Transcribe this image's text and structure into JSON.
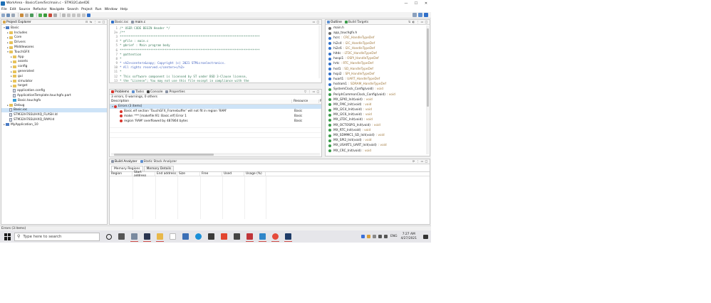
{
  "window": {
    "title": "WorkArea - Basic/Core/Src/main.c - STM32CubeIDE",
    "controls": [
      "—",
      "☐",
      "✕"
    ]
  },
  "menu": [
    "File",
    "Edit",
    "Source",
    "Refactor",
    "Navigate",
    "Search",
    "Project",
    "Run",
    "Window",
    "Help"
  ],
  "project_explorer": {
    "title": "Project Explorer",
    "tree": [
      {
        "label": "Basic",
        "depth": 0,
        "twisty": "▾",
        "icon": "project-icon"
      },
      {
        "label": "Includes",
        "depth": 1,
        "twisty": "▸",
        "icon": "folder-icon"
      },
      {
        "label": "Core",
        "depth": 1,
        "twisty": "▸",
        "icon": "folder-icon"
      },
      {
        "label": "Drivers",
        "depth": 1,
        "twisty": "▸",
        "icon": "folder-icon"
      },
      {
        "label": "Middlewares",
        "depth": 1,
        "twisty": "▸",
        "icon": "folder-icon"
      },
      {
        "label": "TouchGFX",
        "depth": 1,
        "twisty": "▾",
        "icon": "folder-icon"
      },
      {
        "label": "App",
        "depth": 2,
        "twisty": "▸",
        "icon": "folder-icon"
      },
      {
        "label": "assets",
        "depth": 2,
        "twisty": "▸",
        "icon": "folder-icon"
      },
      {
        "label": "config",
        "depth": 2,
        "twisty": "▸",
        "icon": "folder-icon"
      },
      {
        "label": "generated",
        "depth": 2,
        "twisty": "▸",
        "icon": "folder-icon"
      },
      {
        "label": "gui",
        "depth": 2,
        "twisty": "▸",
        "icon": "folder-icon"
      },
      {
        "label": "simulator",
        "depth": 2,
        "twisty": "▸",
        "icon": "folder-icon"
      },
      {
        "label": "target",
        "depth": 2,
        "twisty": "▸",
        "icon": "folder-icon"
      },
      {
        "label": "application.config",
        "depth": 2,
        "twisty": "",
        "icon": "file-icon"
      },
      {
        "label": "ApplicationTemplate.touchgfx.part",
        "depth": 2,
        "twisty": "",
        "icon": "file-icon"
      },
      {
        "label": "Basic.touchgfx",
        "depth": 2,
        "twisty": "",
        "icon": "touchgfx-icon"
      },
      {
        "label": "Debug",
        "depth": 1,
        "twisty": "▸",
        "icon": "folder-icon"
      },
      {
        "label": "Basic.ioc",
        "depth": 1,
        "twisty": "",
        "icon": "file-icon",
        "selected": true
      },
      {
        "label": "STM32H783LIHXQ_FLASH.ld",
        "depth": 1,
        "twisty": "",
        "icon": "file-icon"
      },
      {
        "label": "STM32H783LIHXQ_RAM.ld",
        "depth": 1,
        "twisty": "",
        "icon": "file-icon"
      },
      {
        "label": "MyApplication_10",
        "depth": 0,
        "twisty": "▸",
        "icon": "project-icon"
      }
    ]
  },
  "editor": {
    "tabs": [
      "Basic.ioc",
      "main.c"
    ],
    "lines": [
      {
        "n": "1",
        "text": "/* USER CODE BEGIN Header */",
        "kind": "cm"
      },
      {
        "n": "2⊖",
        "text": "/**",
        "kind": "cm"
      },
      {
        "n": "3",
        "text": "  ******************************************************************************",
        "kind": "cm"
      },
      {
        "n": "4",
        "text": "  * @file           : main.c",
        "kind": "cm"
      },
      {
        "n": "5",
        "text": "  * @brief          : Main program body",
        "kind": "cm"
      },
      {
        "n": "6",
        "text": "  ******************************************************************************",
        "kind": "cm"
      },
      {
        "n": "7",
        "text": "  * @attention",
        "kind": "cm"
      },
      {
        "n": "8",
        "text": "  *",
        "kind": "cm"
      },
      {
        "n": "9",
        "text": "  * <h2><center>&copy; Copyright (c) 2021 STMicroelectronics.",
        "kind": "cm-link"
      },
      {
        "n": "10",
        "text": "  * All rights reserved.</center></h2>",
        "kind": "cm-link"
      },
      {
        "n": "11",
        "text": "  *",
        "kind": "cm"
      },
      {
        "n": "12",
        "text": "  * This software component is licensed by ST under BSD 3-Clause license,",
        "kind": "cm"
      },
      {
        "n": "13",
        "text": "  * the \"License\"; You may not use this file except in compliance with the",
        "kind": "cm"
      }
    ]
  },
  "problems": {
    "tabs": [
      "Problems",
      "Tasks",
      "Console",
      "Properties"
    ],
    "summary": "3 errors, 0 warnings, 0 others",
    "columns": [
      "Description",
      "Resource",
      "P"
    ],
    "group": "Errors (3 items)",
    "rows": [
      {
        "desc": "Basic.elf section 'TouchGFX_Framebuffer' will not fit in region 'RAM'",
        "resource": "Basic"
      },
      {
        "desc": "make: *** [makefile:91: Basic.elf] Error 1",
        "resource": "Basic"
      },
      {
        "desc": "region 'RAM' overflowed by 487864 bytes",
        "resource": "Basic"
      }
    ]
  },
  "outline": {
    "tabs": [
      "Outline",
      "Build Targets"
    ],
    "items": [
      {
        "name": "main.h",
        "type": "",
        "color": "#6b6b6b"
      },
      {
        "name": "app_touchgfx.h",
        "type": "",
        "color": "#6b6b6b"
      },
      {
        "name": "hcrc",
        "type": ": CRC_HandleTypeDef",
        "color": "#2f6fc9"
      },
      {
        "name": "hi2c4",
        "type": ": I2C_HandleTypeDef",
        "color": "#2f6fc9"
      },
      {
        "name": "hi2c6",
        "type": ": I2C_HandleTypeDef",
        "color": "#2f6fc9"
      },
      {
        "name": "hltdc",
        "type": ": LTDC_HandleTypeDef",
        "color": "#2f6fc9"
      },
      {
        "name": "hospi1",
        "type": ": OSPI_HandleTypeDef",
        "color": "#2f6fc9"
      },
      {
        "name": "hrtc",
        "type": ": RTC_HandleTypeDef",
        "color": "#2f6fc9"
      },
      {
        "name": "hsd1",
        "type": ": SD_HandleTypeDef",
        "color": "#2f6fc9"
      },
      {
        "name": "hspi2",
        "type": ": SPI_HandleTypeDef",
        "color": "#2f6fc9"
      },
      {
        "name": "huart1",
        "type": ": UART_HandleTypeDef",
        "color": "#2f6fc9"
      },
      {
        "name": "hsdram1",
        "type": ": SDRAM_HandleTypeDef",
        "color": "#2f6fc9"
      },
      {
        "name": "SystemClock_Config(void)",
        "type": ": void",
        "color": "#3a9c4a"
      },
      {
        "name": "PeriphCommonClock_Config(void)",
        "type": ": void",
        "color": "#3a9c4a"
      },
      {
        "name": "MX_GPIO_Init(void)",
        "type": ": void",
        "color": "#3a9c4a"
      },
      {
        "name": "MX_FMC_Init(void)",
        "type": ": void",
        "color": "#3a9c4a"
      },
      {
        "name": "MX_I2C4_Init(void)",
        "type": ": void",
        "color": "#3a9c4a"
      },
      {
        "name": "MX_I2C6_Init(void)",
        "type": ": void",
        "color": "#3a9c4a"
      },
      {
        "name": "MX_LTDC_Init(void)",
        "type": ": void",
        "color": "#3a9c4a"
      },
      {
        "name": "MX_OCTOSPI1_Init(void)",
        "type": ": void",
        "color": "#3a9c4a"
      },
      {
        "name": "MX_RTC_Init(void)",
        "type": ": void",
        "color": "#3a9c4a"
      },
      {
        "name": "MX_SDMMC1_SD_Init(void)",
        "type": ": void",
        "color": "#3a9c4a"
      },
      {
        "name": "MX_SPI2_Init(void)",
        "type": ": void",
        "color": "#3a9c4a"
      },
      {
        "name": "MX_USART1_UART_Init(void)",
        "type": ": void",
        "color": "#3a9c4a"
      },
      {
        "name": "MX_CRC_Init(void)",
        "type": ": void",
        "color": "#3a9c4a"
      }
    ]
  },
  "build_analyzer": {
    "tabs": [
      "Build Analyzer",
      "Static Stack Analyzer"
    ],
    "subtabs": [
      "Memory Regions",
      "Memory Details"
    ],
    "columns": [
      "Region",
      "Start address",
      "End address",
      "Size",
      "Free",
      "Used",
      "Usage (%)"
    ]
  },
  "status": {
    "text": "Errors (3 items)"
  },
  "taskbar": {
    "search_placeholder": "Type here to search",
    "tray": {
      "lang": "ENG",
      "time": "7:27 AM",
      "date": "4/27/2021"
    }
  },
  "colors": {
    "accent": "#1f6fb5",
    "error": "#d9342b",
    "selection": "#cde3f7"
  }
}
